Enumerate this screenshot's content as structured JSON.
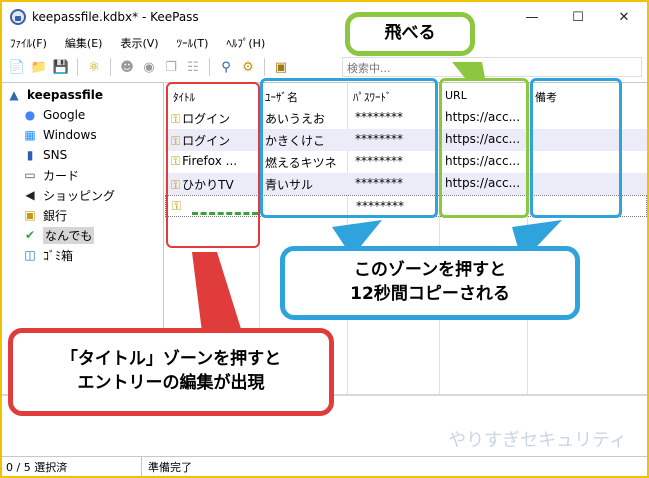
{
  "window": {
    "title": "keepassfile.kdbx* - KeePass"
  },
  "menu": [
    "ﾌｧｲﾙ(F)",
    "編集(E)",
    "表示(V)",
    "ﾂｰﾙ(T)",
    "ﾍﾙﾌﾟ(H)"
  ],
  "search": {
    "placeholder": "検索中..."
  },
  "tree": {
    "root": "keepassfile",
    "items": [
      {
        "label": "Google",
        "icon": "google-icon"
      },
      {
        "label": "Windows",
        "icon": "windows-icon"
      },
      {
        "label": "SNS",
        "icon": "phone-icon"
      },
      {
        "label": "カード",
        "icon": "card-icon"
      },
      {
        "label": "ショッピング",
        "icon": "penguin-icon"
      },
      {
        "label": "銀行",
        "icon": "lock-icon"
      },
      {
        "label": "なんでも",
        "icon": "checkmark-icon"
      },
      {
        "label": "ｺﾞﾐ箱",
        "icon": "recycle-bin-icon"
      }
    ]
  },
  "list": {
    "columns": [
      "ﾀｲﾄﾙ",
      "ﾕｰｻﾞ名",
      "ﾊﾟｽﾜｰﾄﾞ",
      "URL",
      "備考"
    ],
    "rows": [
      {
        "title": "ログイン",
        "user": "あいうえお",
        "password": "********",
        "url": "https://acc...",
        "notes": ""
      },
      {
        "title": "ログイン",
        "user": "かきくけこ",
        "password": "********",
        "url": "https://acc...",
        "notes": ""
      },
      {
        "title": "Firefox  ...",
        "user": "燃えるキツネ",
        "password": "********",
        "url": "https://acc...",
        "notes": ""
      },
      {
        "title": "ひかりTV",
        "user": "青いサル",
        "password": "********",
        "url": "https://acc...",
        "notes": ""
      },
      {
        "title": "",
        "user": "",
        "password": "********",
        "url": "",
        "notes": ""
      }
    ]
  },
  "status": {
    "selection": "0 / 5 選択済",
    "state": "準備完了"
  },
  "watermark": "やりすぎセキュリティ",
  "annotations": {
    "jump": "飛べる",
    "copy_line1": "このゾーンを押すと",
    "copy_line2": "12秒間コピーされる",
    "title_line1": "「タイトル」ゾーンを押すと",
    "title_line2": "エントリーの編集が出現"
  },
  "colors": {
    "frame": "#f0c200",
    "red": "#e03c3c",
    "blue": "#2fa3dc",
    "green": "#8dc63f"
  }
}
